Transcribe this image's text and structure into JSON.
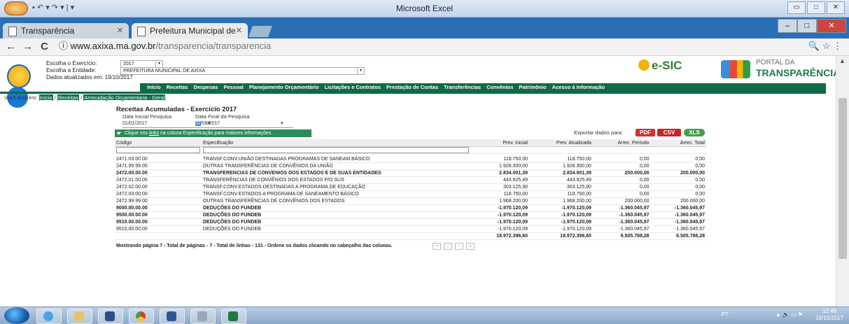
{
  "excel": {
    "title": "Microsoft Excel",
    "qat_text": "▪ ↶ ▾ ↷ ▾ | ▾",
    "window_buttons": [
      "▭",
      "□",
      "✕"
    ]
  },
  "browser": {
    "tabs": [
      {
        "label": "Transparência",
        "close": "✕"
      },
      {
        "label": "Prefeitura Municipal de ",
        "close": "✕"
      }
    ],
    "window_buttons": [
      "–",
      "□",
      "✕"
    ],
    "nav": {
      "back": "←",
      "forward": "→",
      "reload": "C"
    },
    "url_info_icon": "ⓘ",
    "url_host": "www.axixa.ma.gov.br",
    "url_path": "/transparencia/transparencia",
    "right_icons": "🔍  ☆   ⋮"
  },
  "page": {
    "selectors": {
      "exercicio_label": "Escolha o Exercício:",
      "exercicio_value": "2017",
      "entidade_label": "Escolha a Entidade:",
      "entidade_value": "PREFEITURA MUNICIPAL DE AXIXA",
      "dados_label": "Dados atualizados em: 19/10/2017"
    },
    "esic_logo": "e-SIC",
    "portal_l1": "PORTAL DA",
    "portal_l2": "TRANSPARÊNCIA",
    "nav": [
      "Início",
      "Receitas",
      "Despesas",
      "Pessoal",
      "Planejamento Orçamentário",
      "Licitações e Contratos",
      "Prestação de Contas",
      "Transferências",
      "Convênios",
      "Patrimônio",
      "Acesso à Informação"
    ],
    "breadcrumb": {
      "prefix": "Você está em:",
      "items": [
        "Início",
        "Receitas",
        "Arrecadação Orçamentária - Geral"
      ]
    },
    "heading": "Receitas Acumuladas - Exercício 2017",
    "date_ini_label": "Data Inicial Pesquisa",
    "date_fim_label": "Data Final da Pesquisa",
    "date_ini_value": "01/01/2017",
    "date_fim_day": "31",
    "date_fim_rest": "/08/2017",
    "info_pre": "Clique nos ",
    "info_link": "links",
    "info_post": " na coluna Especificação para maiores informações.",
    "export_label": "Exportar dados para:",
    "export_buttons": [
      "PDF",
      "CSV",
      "XLS"
    ],
    "footer": "Mostrando página 7 - Total de páginas - 7 - Total de linhas - 131 - Ordene os dados clicando no cabeçalho das colunas."
  },
  "table": {
    "headers": [
      "Código",
      "Especificação",
      "Prev. Inicial",
      "Prev. Atualizada",
      "Arrec. Período",
      "Arrec. Total"
    ],
    "rows": [
      {
        "bold": false,
        "cells": [
          "2471.03.00.00",
          "TRANSF.CONV.UNIÃO DESTINADAS PROGRAMAS DE SANEAM.BÁSICO",
          "118.750,00",
          "118.750,00",
          "0,00",
          "0,00"
        ]
      },
      {
        "bold": false,
        "cells": [
          "2471.99.99.00",
          "OUTRAS TRANSFERÊNCIAS DE CONVÊNIOS DA UNIÃO",
          "1.928.300,00",
          "1.928.300,00",
          "0,00",
          "0,00"
        ]
      },
      {
        "bold": true,
        "cells": [
          "2472.00.00.00",
          "TRANSFERENCIAS DE CONVENIOS DOS ESTADOS E DE SUAS ENTIDADES",
          "2.834.001,39",
          "2.834.001,39",
          "200.000,00",
          "200.000,00"
        ]
      },
      {
        "bold": false,
        "cells": [
          "2472.01.00.00",
          "TRANSFERÊNCIAS DE CONVÊNIOS DOS ESTADOS P/O SUS",
          "443.925,49",
          "443.925,49",
          "0,00",
          "0,00"
        ]
      },
      {
        "bold": false,
        "cells": [
          "2472.02.00.00",
          "TRANSF.CONV.ESTADOS DESTINADAS A PROGRAMA DE EDUCAÇÃO",
          "303.125,90",
          "303.125,90",
          "0,00",
          "0,00"
        ]
      },
      {
        "bold": false,
        "cells": [
          "2472.03.00.00",
          "TRANSF.CONV.ESTADOS A PROGRAMA DE SANEAMENTO BÁSICO",
          "118.750,00",
          "118.750,00",
          "0,00",
          "0,00"
        ]
      },
      {
        "bold": false,
        "cells": [
          "2472.99.99.00",
          "OUTRAS TRANSFERÊNCIAS DE CONVÊNIOS DOS ESTADOS",
          "1.968.200,00",
          "1.968.200,00",
          "200.000,00",
          "200.000,00"
        ]
      },
      {
        "bold": true,
        "cells": [
          "9000.00.00.00",
          "DEDUÇÕES DO FUNDEB",
          "-1.970.120,09",
          "-1.970.120,09",
          "-1.360.045,97",
          "-1.360.045,97"
        ]
      },
      {
        "bold": true,
        "cells": [
          "9500.00.00.00",
          "DEDUÇÕES DO FUNDEB",
          "-1.970.120,09",
          "-1.970.120,09",
          "-1.360.045,97",
          "-1.360.045,97"
        ]
      },
      {
        "bold": true,
        "cells": [
          "9510.00.00.00",
          "DEDUÇÕES DO FUNDEB",
          "-1.970.120,09",
          "-1.970.120,09",
          "-1.360.045,97",
          "-1.360.045,97"
        ]
      },
      {
        "bold": false,
        "cells": [
          "9510.00.00.00",
          "DEDUÇÕES DO FUNDEB",
          "-1.970.120,09",
          "-1.970.120,09",
          "-1.360.045,97",
          "-1.360.045,97"
        ]
      }
    ],
    "totals": [
      "18.972.396,60",
      "18.972.396,60",
      "6.505.788,28",
      "6.505.788,28"
    ]
  },
  "taskbar": {
    "lang": "PT",
    "tray_icons": "▲  🔊  ▭  ⚑",
    "time": "12:46",
    "date": "19/10/2017"
  },
  "colors": {
    "portal_green": "#0e6b45",
    "pdf_red": "#d32f2f",
    "csv_red": "#c62828",
    "xls_green": "#43a047"
  }
}
